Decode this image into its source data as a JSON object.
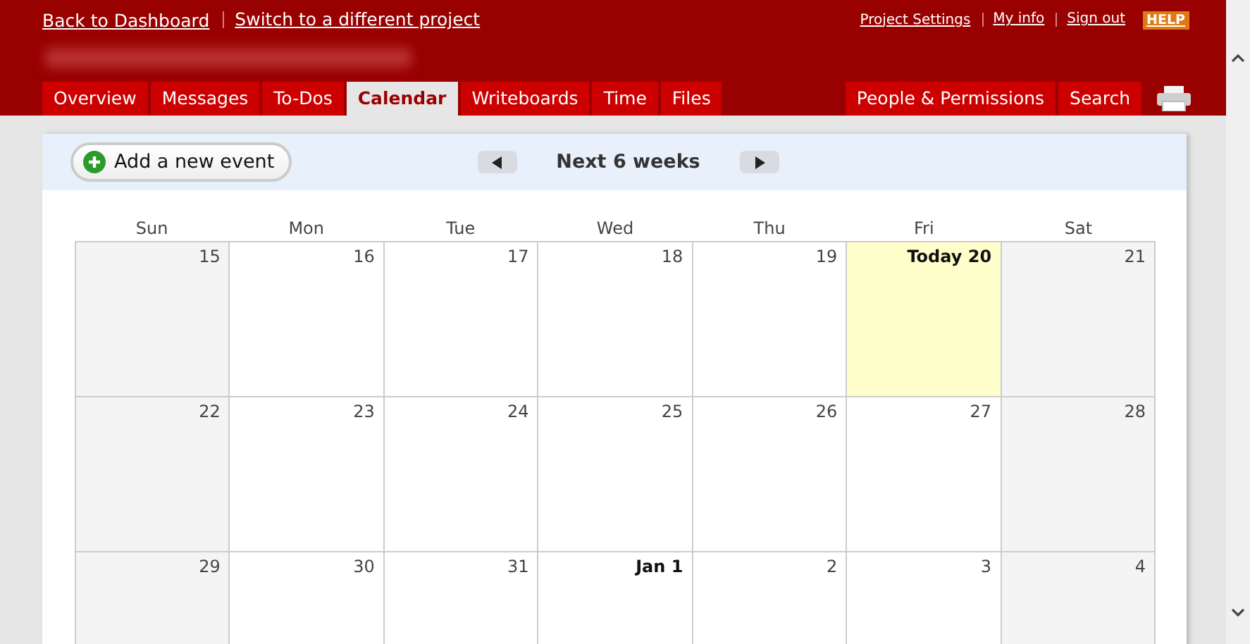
{
  "top_links": [
    "Back to Dashboard",
    "Switch to a different project"
  ],
  "account_links": [
    "Project Settings",
    "My info",
    "Sign out"
  ],
  "help": "HELP",
  "tabs": [
    {
      "label": "Overview",
      "selected": false
    },
    {
      "label": "Messages",
      "selected": false
    },
    {
      "label": "To-Dos",
      "selected": false
    },
    {
      "label": "Calendar",
      "selected": true
    },
    {
      "label": "Writeboards",
      "selected": false
    },
    {
      "label": "Time",
      "selected": false
    },
    {
      "label": "Files",
      "selected": false
    }
  ],
  "right_tabs": [
    {
      "label": "People & Permissions",
      "selected": false
    },
    {
      "label": "Search",
      "selected": false
    }
  ],
  "toolbar": {
    "add_button": "Add a new event",
    "range": "Next 6 weeks"
  },
  "calendar": {
    "weekdays": [
      "Sun",
      "Mon",
      "Tue",
      "Wed",
      "Thu",
      "Fri",
      "Sat"
    ],
    "weeks": [
      [
        {
          "label": "15",
          "kind": "weekend",
          "bold": false
        },
        {
          "label": "16",
          "kind": "weekday",
          "bold": false
        },
        {
          "label": "17",
          "kind": "weekday",
          "bold": false
        },
        {
          "label": "18",
          "kind": "weekday",
          "bold": false
        },
        {
          "label": "19",
          "kind": "weekday",
          "bold": false
        },
        {
          "label": "Today 20",
          "kind": "today",
          "bold": true
        },
        {
          "label": "21",
          "kind": "weekend",
          "bold": false
        }
      ],
      [
        {
          "label": "22",
          "kind": "weekend",
          "bold": false
        },
        {
          "label": "23",
          "kind": "weekday",
          "bold": false
        },
        {
          "label": "24",
          "kind": "weekday",
          "bold": false
        },
        {
          "label": "25",
          "kind": "weekday",
          "bold": false
        },
        {
          "label": "26",
          "kind": "weekday",
          "bold": false
        },
        {
          "label": "27",
          "kind": "weekday",
          "bold": false
        },
        {
          "label": "28",
          "kind": "weekend",
          "bold": false
        }
      ],
      [
        {
          "label": "29",
          "kind": "weekend",
          "bold": false
        },
        {
          "label": "30",
          "kind": "weekday",
          "bold": false
        },
        {
          "label": "31",
          "kind": "weekday",
          "bold": false
        },
        {
          "label": "Jan 1",
          "kind": "weekday",
          "bold": true
        },
        {
          "label": "2",
          "kind": "weekday",
          "bold": false
        },
        {
          "label": "3",
          "kind": "weekday",
          "bold": false
        },
        {
          "label": "4",
          "kind": "weekend",
          "bold": false
        }
      ]
    ]
  }
}
